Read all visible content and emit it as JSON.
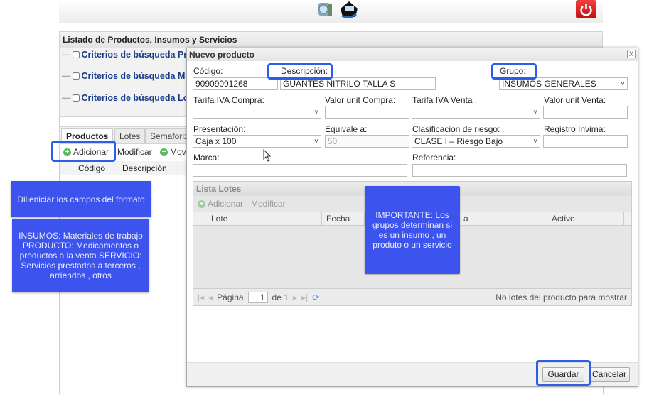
{
  "header": {
    "icons": [
      "network-computer-icon",
      "home-icon"
    ],
    "power_icon": "power-icon",
    "power_color": "#d9201a"
  },
  "listado": {
    "title": "Listado de Productos, Insumos y Servicios",
    "criteria": [
      "Criterios de búsqueda Prod",
      "Criterios de búsqueda Movi",
      "Criterios de búsqueda Lotes"
    ]
  },
  "tabs": [
    "Productos",
    "Lotes",
    "Semaforiza"
  ],
  "toolbar": {
    "add": "Adicionar",
    "modify": "Modificar",
    "move": "Movi"
  },
  "grid": {
    "columns": [
      "Código",
      "Descripción"
    ]
  },
  "callouts": {
    "fill": "Dilieniciar los campos del formato",
    "groups": "INSUMOS: Materiales de trabajo PRODUCTO: Medicamentos o productos a la venta SERVICIO: Servicios prestados a terceros , arriendos , otros",
    "important": "IMPORTANTE: Los grupos determinan si es un insumo , un produto o un servicio",
    "color": "#3c53ee"
  },
  "dialog": {
    "title": "Nuevo producto",
    "close": "X",
    "fields": {
      "codigo": {
        "label": "Código:",
        "value": "90909091268"
      },
      "descripcion": {
        "label": "Descripción:",
        "value": "GUANTES NITRILO TALLA S"
      },
      "grupo": {
        "label": "Grupo:",
        "value": "INSUMOS GENERALES"
      },
      "iva_compra": {
        "label": "Tarifa IVA Compra:",
        "value": ""
      },
      "valor_compra": {
        "label": "Valor unit Compra:",
        "value": ""
      },
      "iva_venta": {
        "label": "Tarifa IVA Venta :",
        "value": ""
      },
      "valor_venta": {
        "label": "Valor unit Venta:",
        "value": ""
      },
      "presentacion": {
        "label": "Presentación:",
        "value": "Caja x 100"
      },
      "equivale": {
        "label": "Equivale a:",
        "value": "50"
      },
      "riesgo": {
        "label": "Clasificacion de riesgo:",
        "value": "CLASE I – Riesgo Bajo"
      },
      "invima": {
        "label": "Registro Invima:",
        "value": ""
      },
      "marca": {
        "label": "Marca:",
        "value": ""
      },
      "referencia": {
        "label": "Referencia:",
        "value": ""
      }
    },
    "lotes": {
      "title": "Lista Lotes",
      "add": "Adicionar",
      "modify": "Modificar",
      "columns": [
        "Lote",
        "Fecha venc",
        "a",
        "Activo"
      ],
      "pager": {
        "page_label": "Página",
        "page": "1",
        "of": "de 1",
        "empty": "No lotes del producto para mostrar"
      }
    },
    "save": "Guardar",
    "cancel": "Cancelar"
  },
  "highlight_color": "#2d5ee8"
}
